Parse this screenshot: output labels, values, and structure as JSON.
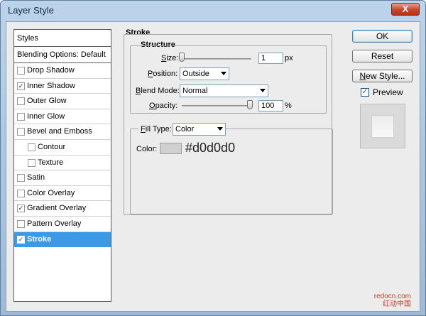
{
  "window": {
    "title": "Layer Style",
    "close_glyph": "X"
  },
  "styles": {
    "header": "Styles",
    "blending_options": "Blending Options: Default",
    "items": [
      {
        "label": "Drop Shadow",
        "checked": false,
        "sub": false,
        "selected": false
      },
      {
        "label": "Inner Shadow",
        "checked": true,
        "sub": false,
        "selected": false
      },
      {
        "label": "Outer Glow",
        "checked": false,
        "sub": false,
        "selected": false
      },
      {
        "label": "Inner Glow",
        "checked": false,
        "sub": false,
        "selected": false
      },
      {
        "label": "Bevel and Emboss",
        "checked": false,
        "sub": false,
        "selected": false
      },
      {
        "label": "Contour",
        "checked": false,
        "sub": true,
        "selected": false
      },
      {
        "label": "Texture",
        "checked": false,
        "sub": true,
        "selected": false
      },
      {
        "label": "Satin",
        "checked": false,
        "sub": false,
        "selected": false
      },
      {
        "label": "Color Overlay",
        "checked": false,
        "sub": false,
        "selected": false
      },
      {
        "label": "Gradient Overlay",
        "checked": true,
        "sub": false,
        "selected": false
      },
      {
        "label": "Pattern Overlay",
        "checked": false,
        "sub": false,
        "selected": false
      },
      {
        "label": "Stroke",
        "checked": true,
        "sub": false,
        "selected": true
      }
    ]
  },
  "stroke": {
    "title": "Stroke",
    "structure_title": "Structure",
    "size_label": "Size:",
    "size_value": "1",
    "size_unit": "px",
    "position_label": "Position:",
    "position_value": "Outside",
    "blend_mode_label": "Blend Mode:",
    "blend_mode_value": "Normal",
    "opacity_label": "Opacity:",
    "opacity_value": "100",
    "opacity_unit": "%",
    "fill_type_label": "Fill Type:",
    "fill_type_value": "Color",
    "color_label": "Color:",
    "color_swatch": "#d0d0d0",
    "color_hex_text": "#d0d0d0"
  },
  "buttons": {
    "ok": "OK",
    "reset": "Reset",
    "new_style": "New Style...",
    "preview_label": "Preview",
    "preview_checked": true
  },
  "watermark": {
    "line1": "redocn.com",
    "line2": "红动中国"
  },
  "colors": {
    "selection": "#3a9ae8",
    "titlebar": "#bcd3ea"
  }
}
